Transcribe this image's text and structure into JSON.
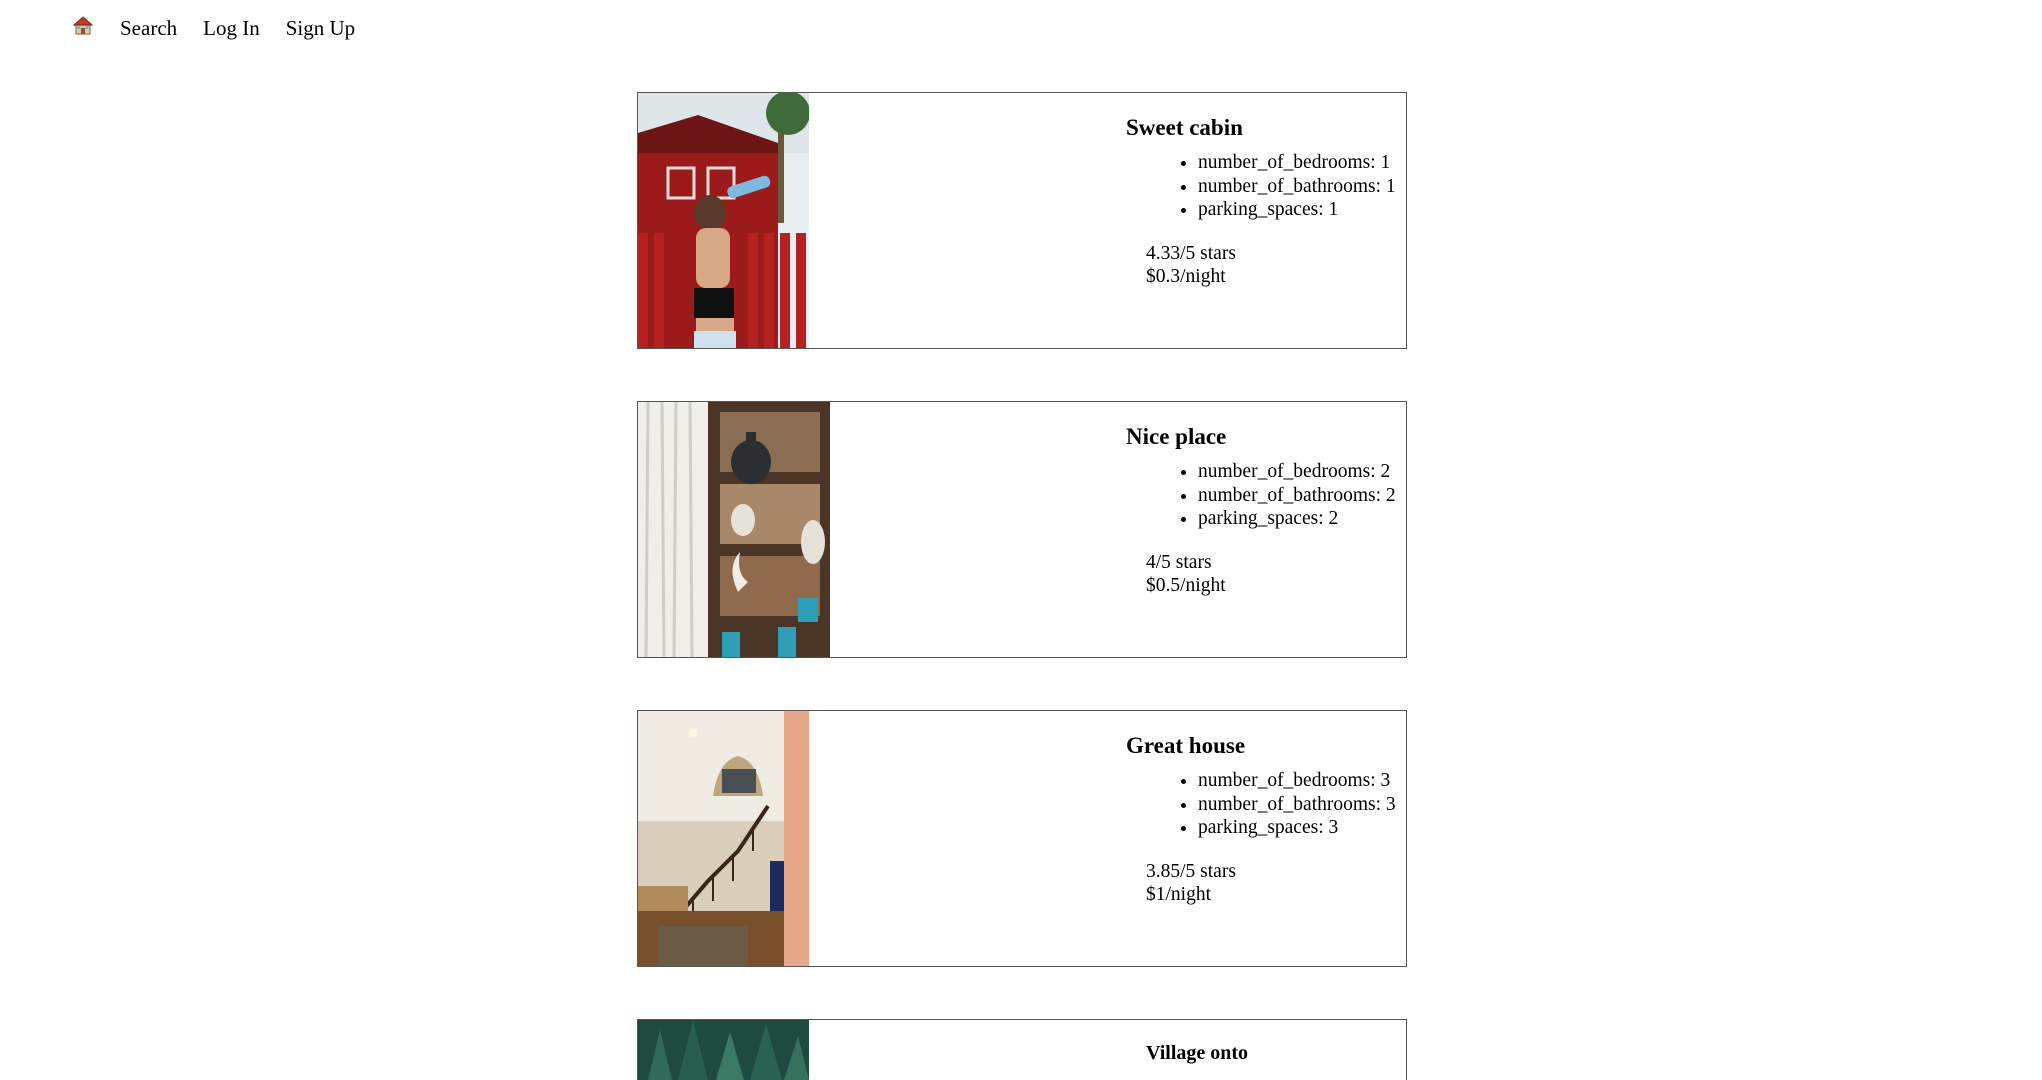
{
  "nav": {
    "home_icon": "house-emoji-icon",
    "search_label": "Search",
    "login_label": "Log In",
    "signup_label": "Sign Up"
  },
  "listings": [
    {
      "title": "Sweet cabin",
      "features": [
        "number_of_bedrooms: 1",
        "number_of_bathrooms: 1",
        "parking_spaces: 1"
      ],
      "rating": "4.33/5 stars",
      "price": "$0.3/night",
      "photo": "woman drinking water in front of red cabin"
    },
    {
      "title": "Nice place",
      "features": [
        "number_of_bedrooms: 2",
        "number_of_bathrooms: 2",
        "parking_spaces: 2"
      ],
      "rating": "4/5 stars",
      "price": "$0.5/night",
      "photo": "interior shelves with vases beside curtain"
    },
    {
      "title": "Great house",
      "features": [
        "number_of_bedrooms: 3",
        "number_of_bathrooms: 3",
        "parking_spaces: 3"
      ],
      "rating": "3.85/5 stars",
      "price": "$1/night",
      "photo": "entry hall with curved staircase"
    },
    {
      "title": "Village onto",
      "photo": "pine forest"
    }
  ]
}
